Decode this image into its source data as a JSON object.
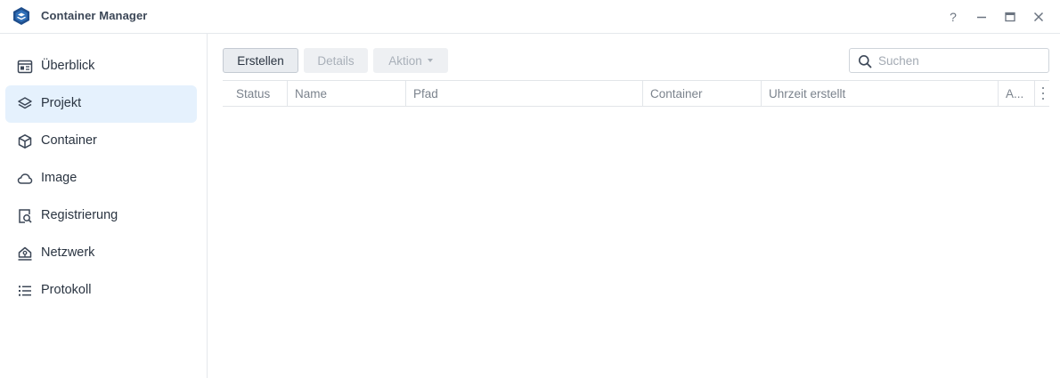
{
  "window": {
    "title": "Container Manager",
    "controls": [
      {
        "name": "help-button",
        "icon": "help-icon",
        "glyph": "?"
      },
      {
        "name": "minimize-button",
        "icon": "minimize-icon",
        "glyph": "—"
      },
      {
        "name": "maximize-button",
        "icon": "maximize-icon",
        "glyph": ""
      },
      {
        "name": "close-button",
        "icon": "close-icon",
        "glyph": "✕"
      }
    ]
  },
  "sidebar": {
    "items": [
      {
        "label": "Überblick",
        "icon": "overview-icon",
        "active": false
      },
      {
        "label": "Projekt",
        "icon": "layers-icon",
        "active": true
      },
      {
        "label": "Container",
        "icon": "cube-icon",
        "active": false
      },
      {
        "label": "Image",
        "icon": "cloud-icon",
        "active": false
      },
      {
        "label": "Registrierung",
        "icon": "registry-search-icon",
        "active": false
      },
      {
        "label": "Netzwerk",
        "icon": "network-icon",
        "active": false
      },
      {
        "label": "Protokoll",
        "icon": "list-icon",
        "active": false
      }
    ]
  },
  "toolbar": {
    "create_label": "Erstellen",
    "details_label": "Details",
    "action_label": "Aktion"
  },
  "search": {
    "placeholder": "Suchen",
    "value": ""
  },
  "table": {
    "columns": [
      "Status",
      "Name",
      "Pfad",
      "Container",
      "Uhrzeit erstellt",
      "A..."
    ],
    "rows": []
  },
  "colors": {
    "accent": "#e5f1fd",
    "logo": "#1f4e8c",
    "text": "#2a3441",
    "muted": "#7b838d"
  }
}
